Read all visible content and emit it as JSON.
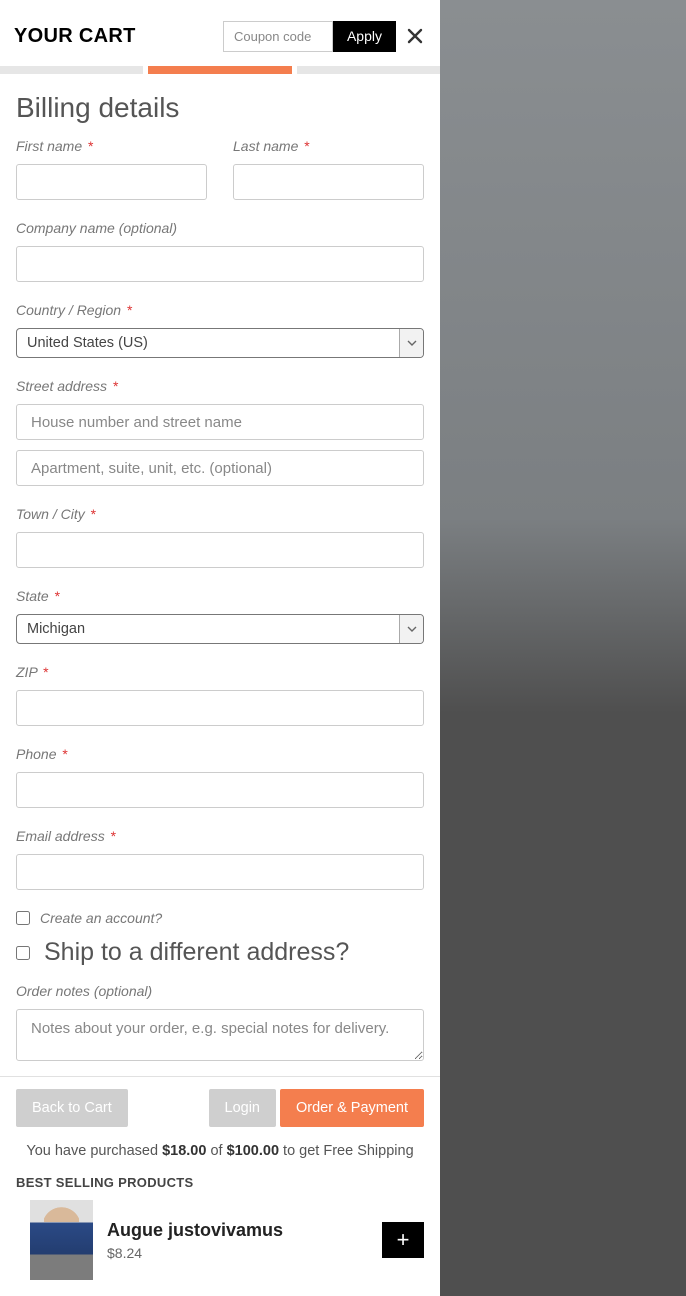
{
  "header": {
    "title": "YOUR CART",
    "coupon_placeholder": "Coupon code",
    "apply_label": "Apply"
  },
  "steps": {
    "count": 3,
    "active_index": 1
  },
  "billing": {
    "section_title": "Billing details",
    "first_name_label": "First name",
    "last_name_label": "Last name",
    "company_label": "Company name (optional)",
    "country_label": "Country / Region",
    "country_value": "United States (US)",
    "street_label": "Street address",
    "street_ph": "House number and street name",
    "street2_ph": "Apartment, suite, unit, etc. (optional)",
    "city_label": "Town / City",
    "state_label": "State",
    "state_value": "Michigan",
    "zip_label": "ZIP",
    "phone_label": "Phone",
    "email_label": "Email address",
    "create_account_label": "Create an account?",
    "ship_diff_label": "Ship to a different address?",
    "notes_label": "Order notes (optional)",
    "notes_ph": "Notes about your order, e.g. special notes for delivery.",
    "required_mark": "*"
  },
  "footer": {
    "back_label": "Back to Cart",
    "login_label": "Login",
    "order_label": "Order & Payment",
    "freeship_pre": "You have purchased ",
    "freeship_purchased": "$18.00",
    "freeship_mid": " of ",
    "freeship_target": "$100.00",
    "freeship_post": " to get Free Shipping",
    "best_title": "BEST SELLING PRODUCTS"
  },
  "product": {
    "name": "Augue justovivamus",
    "price": "$8.24",
    "add_glyph": "+"
  },
  "colors": {
    "accent": "#f47e4e"
  }
}
